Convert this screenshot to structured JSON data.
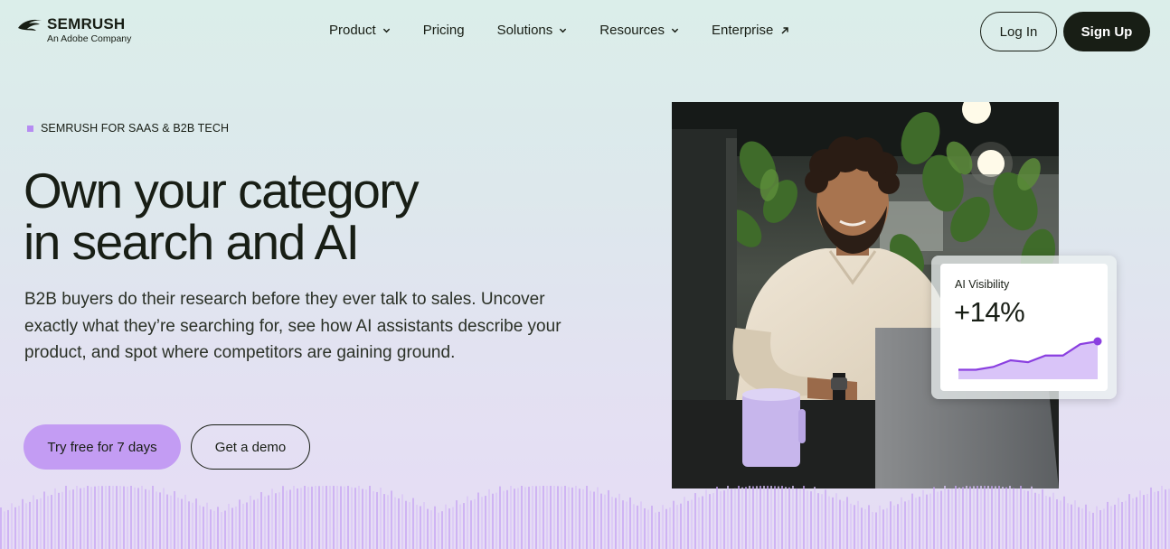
{
  "brand": {
    "name": "SEMRUSH",
    "subtitle": "An Adobe Company"
  },
  "nav": {
    "items": [
      {
        "label": "Product",
        "icon": "chevron-down-icon"
      },
      {
        "label": "Pricing"
      },
      {
        "label": "Solutions",
        "icon": "chevron-down-icon"
      },
      {
        "label": "Resources",
        "icon": "chevron-down-icon"
      },
      {
        "label": "Enterprise",
        "icon": "external-arrow-icon"
      }
    ],
    "login_label": "Log In",
    "signup_label": "Sign Up"
  },
  "hero": {
    "eyebrow": "SEMRUSH FOR SAAS & B2B TECH",
    "headline_line1": "Own your category",
    "headline_line2": "in search and AI",
    "description": "B2B buyers do their research before they ever talk to sales. Uncover exactly what they’re searching for, see how AI assistants describe your product, and spot where competitors are gaining ground.",
    "primary_cta": "Try free for 7 days",
    "secondary_cta": "Get a demo"
  },
  "visibility_card": {
    "label": "AI Visibility",
    "value": "+14%",
    "trend": [
      10,
      10,
      13,
      20,
      18,
      25,
      25,
      37,
      40
    ]
  },
  "colors": {
    "accent": "#c39cf3",
    "accent_dark": "#8a3fe0",
    "text": "#181e15",
    "button_dark": "#181e15"
  }
}
